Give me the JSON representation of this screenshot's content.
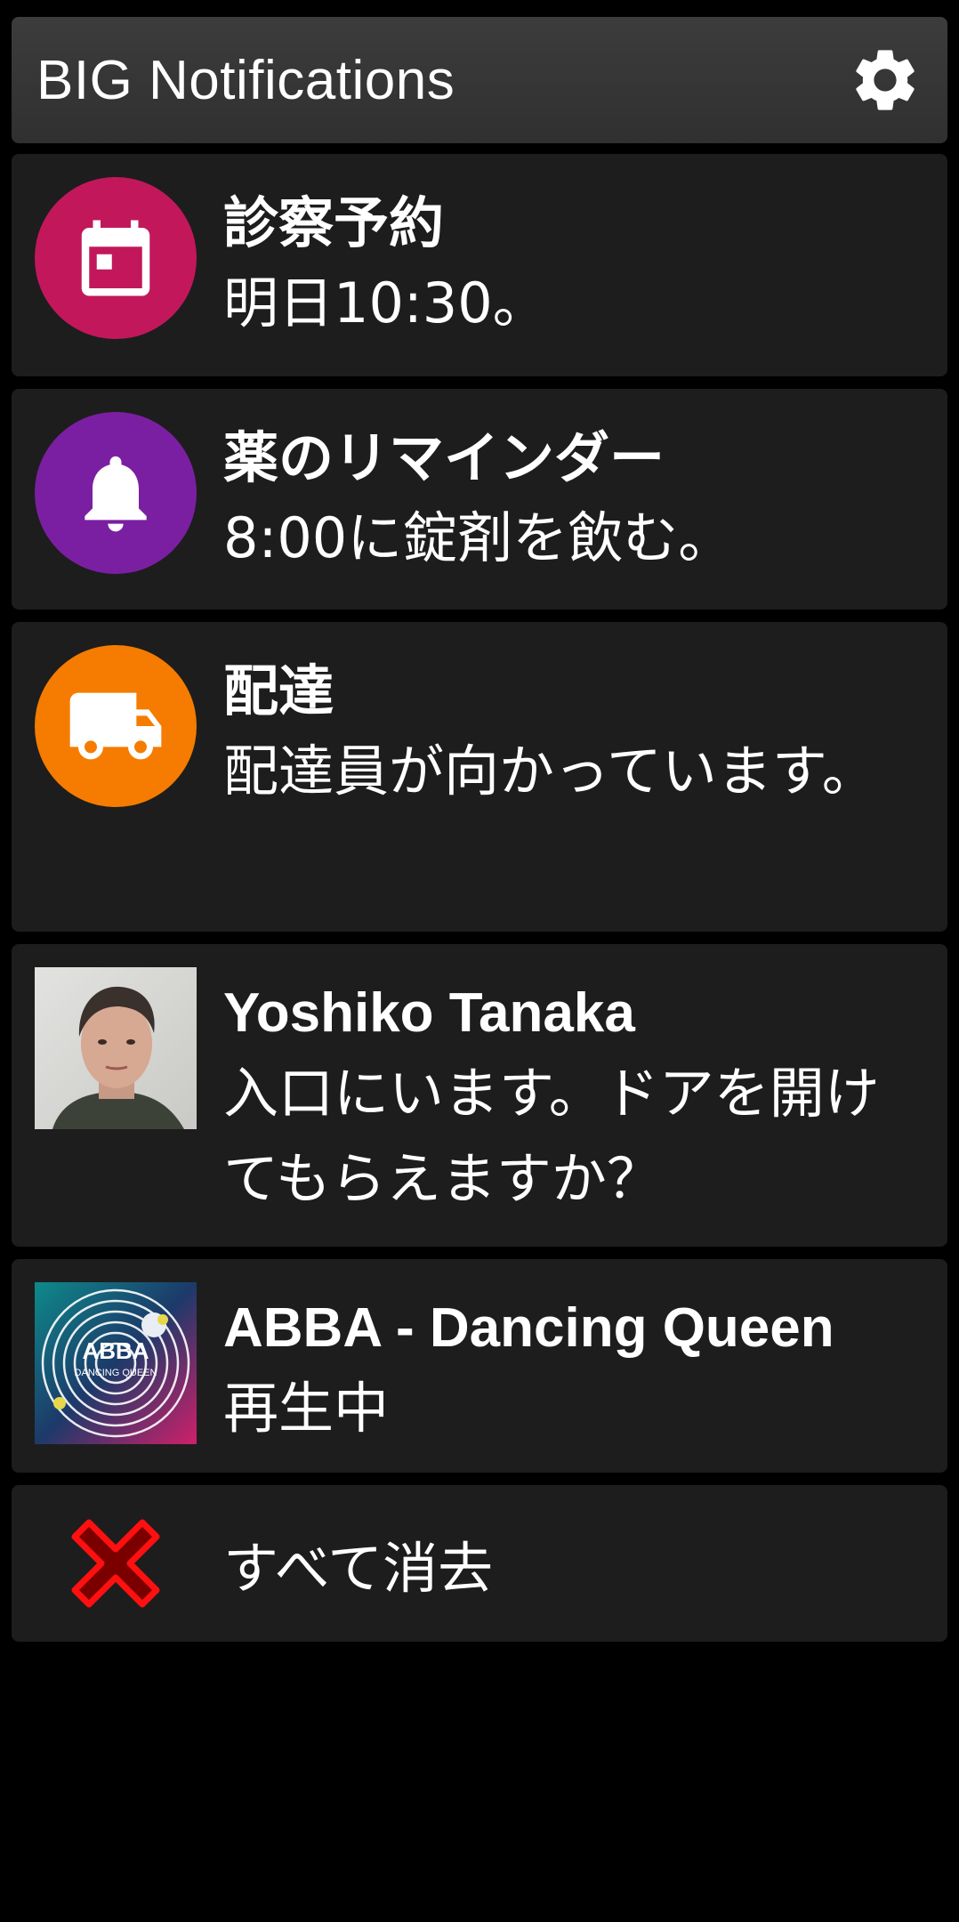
{
  "header": {
    "title": "BIG Notifications",
    "settings_icon": "gear-icon"
  },
  "notifications": [
    {
      "title": "診察予約",
      "body": "明日10:30。",
      "icon": "calendar-icon",
      "icon_color": "#c2185b"
    },
    {
      "title": "薬のリマインダー",
      "body": "8:00に錠剤を飲む。",
      "icon": "bell-icon",
      "icon_color": "#7b1fa2"
    },
    {
      "title": "配達",
      "body": "配達員が向かっています。",
      "icon": "truck-icon",
      "icon_color": "#f57c00"
    },
    {
      "title": "Yoshiko Tanaka",
      "body": "入口にいます。ドアを開けてもらえますか？",
      "icon": "contact-photo",
      "icon_color": "#d8d8d8"
    },
    {
      "title": "ABBA - Dancing Queen",
      "body": "再生中",
      "icon": "album-art",
      "album_text": "ABBA",
      "album_subtext": "DANCING QUEEN",
      "icon_color": "#1e7d84"
    }
  ],
  "clear_all": {
    "label": "すべて消去",
    "icon": "close-x-icon",
    "icon_color": "#e00000"
  },
  "colors": {
    "background": "#000000",
    "card": "#1d1d1d",
    "header": "#363636",
    "text": "#ffffff"
  }
}
